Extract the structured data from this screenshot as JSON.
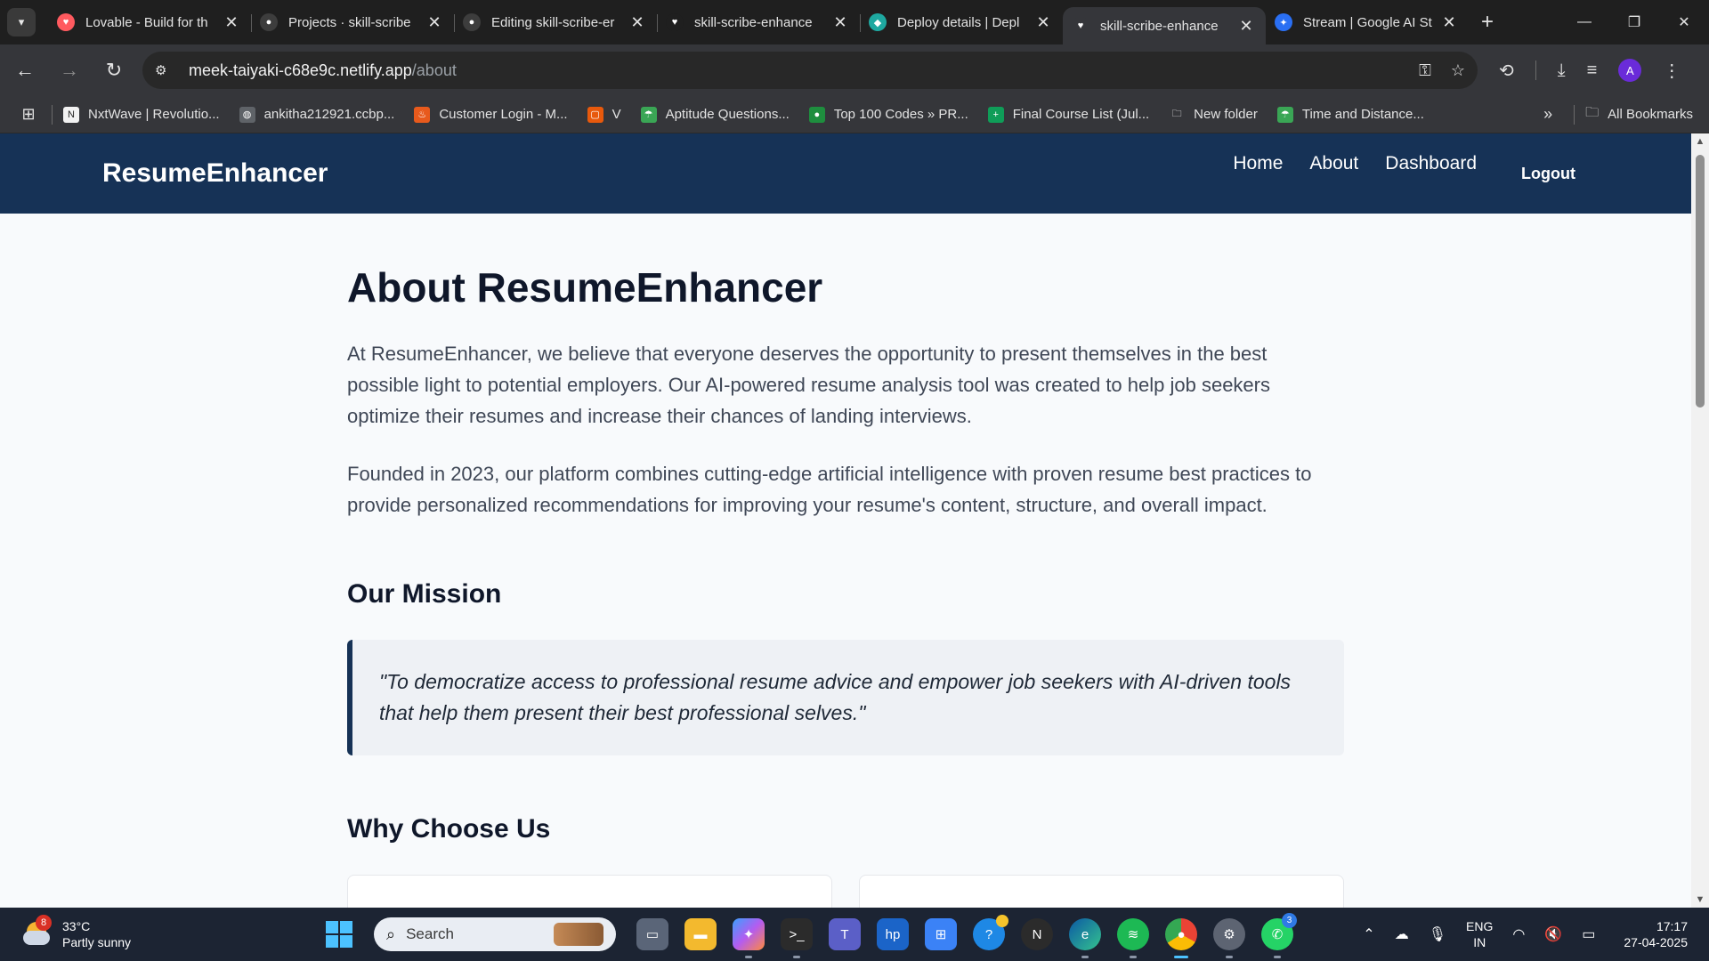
{
  "browser": {
    "tabs": [
      {
        "title": "Lovable - Build for th",
        "favicon_color": "#ff5a5f",
        "glyph": "♥"
      },
      {
        "title": "Projects · skill-scribe",
        "favicon_color": "#3d3d3d",
        "glyph": "●"
      },
      {
        "title": "Editing skill-scribe-er",
        "favicon_color": "#3d3d3d",
        "glyph": "●"
      },
      {
        "title": "skill-scribe-enhance",
        "favicon_color": "#1f1f1f",
        "glyph": "♥"
      },
      {
        "title": "Deploy details | Depl",
        "favicon_color": "#1ea8a0",
        "glyph": "◆"
      },
      {
        "title": "skill-scribe-enhance",
        "favicon_color": "#35363a",
        "glyph": "♥",
        "active": true
      },
      {
        "title": "Stream | Google AI St",
        "favicon_color": "#2a6ff3",
        "glyph": "✦"
      }
    ],
    "url_host": "meek-taiyaki-c68e9c.netlify.app",
    "url_path": "/about",
    "profile_initial": "A",
    "bookmarks": [
      {
        "label": "NxtWave | Revolutio...",
        "color": "#f2f2f2",
        "glyph": "N"
      },
      {
        "label": "ankitha212921.ccbp...",
        "color": "#5f6368",
        "glyph": "◍"
      },
      {
        "label": "Customer Login - M...",
        "color": "#e85a1c",
        "glyph": "♨"
      },
      {
        "label": "V",
        "color": "#e8590c",
        "glyph": "▢"
      },
      {
        "label": "Aptitude Questions...",
        "color": "#3aa655",
        "glyph": "☂"
      },
      {
        "label": "Top 100 Codes » PR...",
        "color": "#1e8e3e",
        "glyph": "●"
      },
      {
        "label": "Final Course List (Jul...",
        "color": "#0f9d58",
        "glyph": "+"
      },
      {
        "label": "New folder",
        "color": "transparent",
        "glyph": "🗀"
      },
      {
        "label": "Time and Distance...",
        "color": "#3aa655",
        "glyph": "☂"
      }
    ],
    "all_bookmarks": "All Bookmarks"
  },
  "app": {
    "brand": "ResumeEnhancer",
    "nav": [
      "Home",
      "About",
      "Dashboard"
    ],
    "logout": "Logout"
  },
  "page": {
    "title": "About ResumeEnhancer",
    "intro_1": "At ResumeEnhancer, we believe that everyone deserves the opportunity to present themselves in the best possible light to potential employers. Our AI-powered resume analysis tool was created to help job seekers optimize their resumes and increase their chances of landing interviews.",
    "intro_2": "Founded in 2023, our platform combines cutting-edge artificial intelligence with proven resume best practices to provide personalized recommendations for improving your resume's content, structure, and overall impact.",
    "mission_heading": "Our Mission",
    "mission_quote": "\"To democratize access to professional resume advice and empower job seekers with AI-driven tools that help them present their best professional selves.\"",
    "why_heading": "Why Choose Us"
  },
  "taskbar": {
    "weather_temp": "33°C",
    "weather_desc": "Partly sunny",
    "weather_badge": "8",
    "search_placeholder": "Search",
    "lang_1": "ENG",
    "lang_2": "IN",
    "time": "17:17",
    "date": "27-04-2025",
    "teams_badge": "3",
    "whatsapp_badge": "3"
  },
  "colors": {
    "header_bg": "#163256",
    "accent_border": "#163256"
  }
}
